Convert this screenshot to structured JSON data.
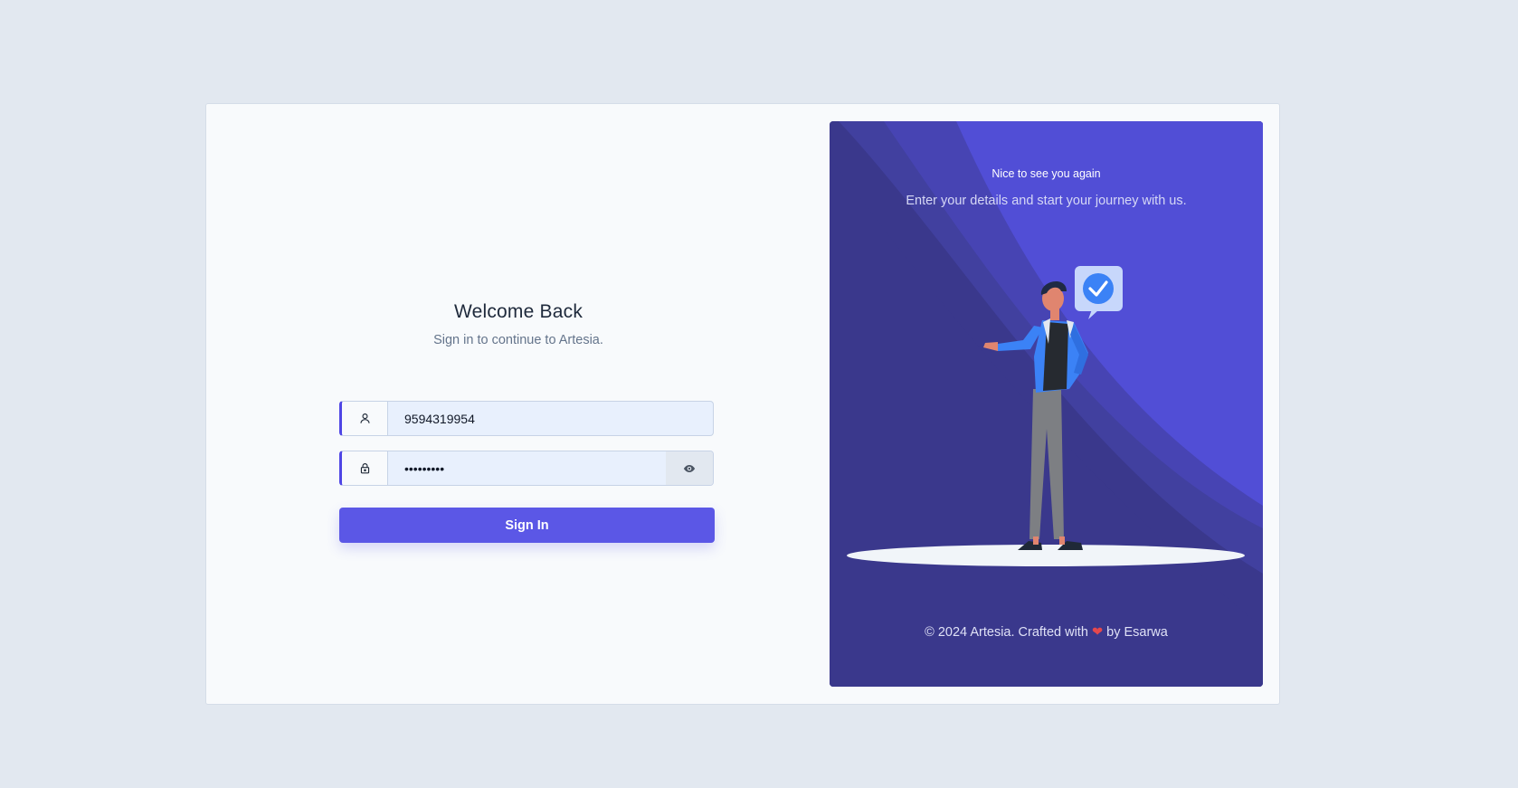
{
  "login": {
    "title": "Welcome Back",
    "subtitle": "Sign in to continue to Artesia.",
    "username_value": "9594319954",
    "password_value": "*********",
    "sign_in_label": "Sign In"
  },
  "panel": {
    "greeting": "Nice to see you again",
    "tagline": "Enter your details and start your journey with us.",
    "footer_prefix": "© 2024 Artesia. Crafted with",
    "footer_heart": "❤",
    "footer_suffix": "by Esarwa"
  },
  "icons": {
    "user": "user-icon",
    "lock": "lock-icon",
    "eye": "eye-icon",
    "check": "check-icon",
    "heart": "heart-icon"
  },
  "colors": {
    "page_bg": "#e2e8f0",
    "accent": "#5b57e6",
    "panel_bg": "#3b3a8f",
    "panel_light": "#5250d6",
    "input_bg": "#e8f0fd"
  }
}
